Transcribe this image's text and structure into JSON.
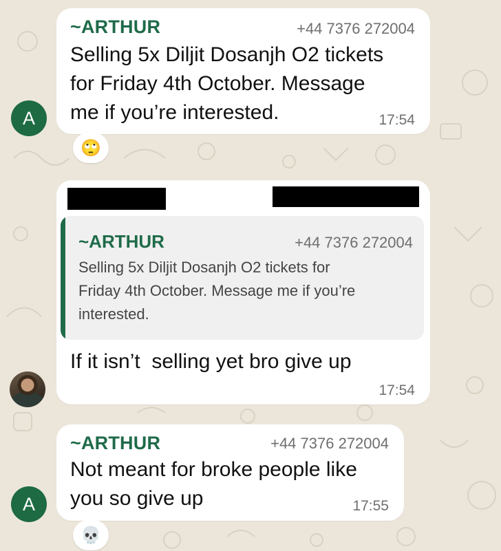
{
  "colors": {
    "chat_background": "#ece6da",
    "bubble": "#ffffff",
    "sender_name": "#1f6b4a",
    "avatar_bg": "#1d6a43",
    "quote_bar": "#1f6b4a",
    "quote_bg": "#f0f0f0"
  },
  "messages": [
    {
      "avatar_letter": "A",
      "sender": "~ARTHUR",
      "phone": "+44 7376 272004",
      "text_lines": [
        "Selling 5x Diljit Dosanjh O2 tickets",
        "for Friday 4th October. Message",
        "me if you’re interested."
      ],
      "time": "17:54",
      "reaction": "🙄"
    },
    {
      "avatar": "profile-photo",
      "quoted": {
        "sender": "~ARTHUR",
        "phone": "+44 7376 272004",
        "text_lines": [
          "Selling 5x Diljit Dosanjh O2 tickets for",
          "Friday 4th October. Message me if you’re",
          "interested."
        ]
      },
      "text": "If it isn’t  selling yet bro give up",
      "time": "17:54"
    },
    {
      "avatar_letter": "A",
      "sender": "~ARTHUR",
      "phone": "+44 7376 272004",
      "text_lines": [
        "Not meant for broke people like",
        "you so give up"
      ],
      "time": "17:55",
      "reaction": "💀"
    }
  ]
}
